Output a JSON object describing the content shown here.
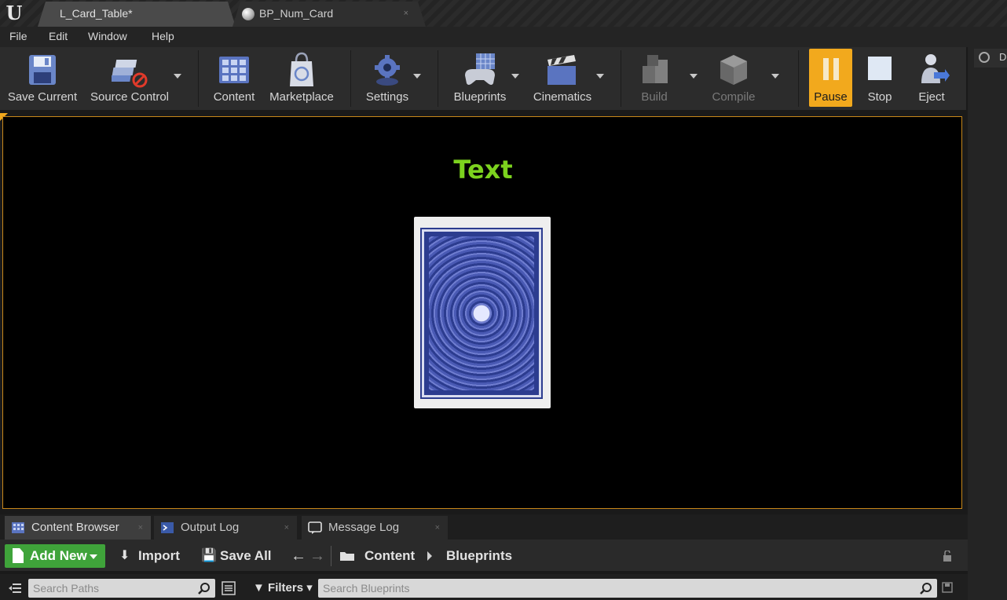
{
  "tabs": {
    "level_tab": "L_Card_Table*",
    "blueprint_tab": "BP_Num_Card",
    "close_glyph": "×"
  },
  "menu": {
    "file": "File",
    "edit": "Edit",
    "window": "Window",
    "help": "Help"
  },
  "toolbar": {
    "save_current": "Save Current",
    "source_control": "Source Control",
    "content": "Content",
    "marketplace": "Marketplace",
    "settings": "Settings",
    "blueprints": "Blueprints",
    "cinematics": "Cinematics",
    "build": "Build",
    "compile": "Compile",
    "pause": "Pause",
    "stop": "Stop",
    "eject": "Eject"
  },
  "details_tab": {
    "label": "D"
  },
  "viewport": {
    "world_text": "Text",
    "world_text_color": "#7cd21e"
  },
  "panel_tabs": {
    "content_browser": "Content Browser",
    "output_log": "Output Log",
    "message_log": "Message Log"
  },
  "content_browser": {
    "add_new": "Add New",
    "import": "Import",
    "save_all": "Save All",
    "path_root": "Content",
    "path_current": "Blueprints",
    "search_paths_placeholder": "Search Paths",
    "filters": "Filters",
    "search_assets_placeholder": "Search Blueprints"
  },
  "colors": {
    "accent_orange": "#f2a91d",
    "add_new_green": "#3fa33a",
    "card_blue": "#2c3c8f"
  }
}
